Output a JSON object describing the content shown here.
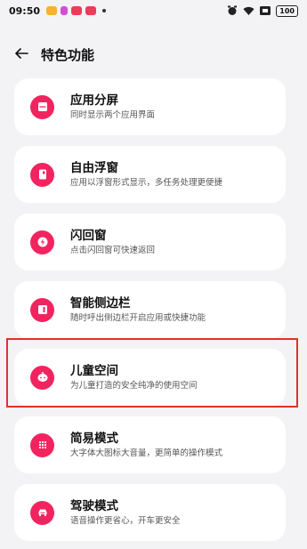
{
  "status_bar": {
    "time": "09:50",
    "notification_colors": [
      "#f7b12a",
      "#d94bd6",
      "#ef3a5a",
      "#ef3a5a"
    ],
    "battery": "100"
  },
  "header": {
    "title": "特色功能",
    "back_icon": "back-arrow-icon"
  },
  "accent_color": "#f2245f",
  "highlight_color": "#e0322b",
  "features": [
    {
      "title": "应用分屏",
      "desc": "同时显示两个应用界面",
      "icon": "split-screen-icon"
    },
    {
      "title": "自由浮窗",
      "desc": "应用以浮窗形式显示，多任务处理更便捷",
      "icon": "floating-window-icon"
    },
    {
      "title": "闪回窗",
      "desc": "点击闪回窗可快速返回",
      "icon": "flashback-icon"
    },
    {
      "title": "智能侧边栏",
      "desc": "随时呼出侧边栏开启应用或快捷功能",
      "icon": "sidebar-icon"
    },
    {
      "title": "儿童空间",
      "desc": "为儿童打造的安全纯净的使用空间",
      "icon": "kids-space-icon"
    },
    {
      "title": "简易模式",
      "desc": "大字体大图标大音量，更简单的操作模式",
      "icon": "simple-mode-icon"
    },
    {
      "title": "驾驶模式",
      "desc": "语音操作更省心，开车更安全",
      "icon": "driving-mode-icon"
    }
  ]
}
